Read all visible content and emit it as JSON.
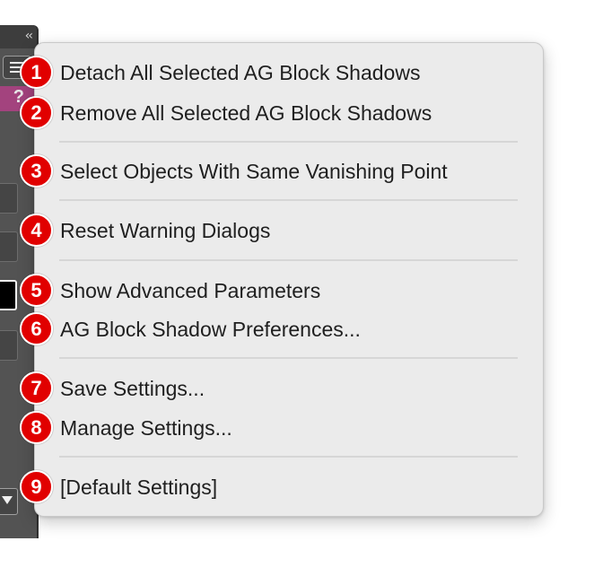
{
  "panel": {
    "collapse_icon": "‹‹",
    "help_icon": "?",
    "accent_color": "#a3437e"
  },
  "menu": {
    "items": [
      {
        "number": "1",
        "label": "Detach All Selected AG Block Shadows"
      },
      {
        "number": "2",
        "label": "Remove All Selected AG Block Shadows"
      },
      {
        "number": "3",
        "label": "Select Objects With Same Vanishing Point"
      },
      {
        "number": "4",
        "label": "Reset Warning Dialogs"
      },
      {
        "number": "5",
        "label": "Show Advanced Parameters"
      },
      {
        "number": "6",
        "label": "AG Block Shadow Preferences..."
      },
      {
        "number": "7",
        "label": "Save Settings..."
      },
      {
        "number": "8",
        "label": "Manage Settings..."
      },
      {
        "number": "9",
        "label": "[Default Settings]"
      }
    ]
  },
  "colors": {
    "badge": "#e10000",
    "menu_background": "#ebebeb",
    "panel_background": "#535353"
  }
}
